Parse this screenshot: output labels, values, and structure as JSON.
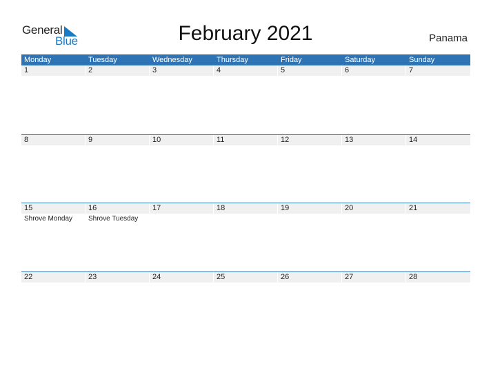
{
  "logo": {
    "line1": "General",
    "line2": "Blue",
    "accent": "#1a7bc4"
  },
  "title": "February 2021",
  "country": "Panama",
  "colors": {
    "header_bg": "#2e74b5",
    "date_bg": "#f0f0f0"
  },
  "weekdays": [
    "Monday",
    "Tuesday",
    "Wednesday",
    "Thursday",
    "Friday",
    "Saturday",
    "Sunday"
  ],
  "weeks": [
    {
      "days": [
        {
          "date": "1",
          "event": ""
        },
        {
          "date": "2",
          "event": ""
        },
        {
          "date": "3",
          "event": ""
        },
        {
          "date": "4",
          "event": ""
        },
        {
          "date": "5",
          "event": ""
        },
        {
          "date": "6",
          "event": ""
        },
        {
          "date": "7",
          "event": ""
        }
      ]
    },
    {
      "days": [
        {
          "date": "8",
          "event": ""
        },
        {
          "date": "9",
          "event": ""
        },
        {
          "date": "10",
          "event": ""
        },
        {
          "date": "11",
          "event": ""
        },
        {
          "date": "12",
          "event": ""
        },
        {
          "date": "13",
          "event": ""
        },
        {
          "date": "14",
          "event": ""
        }
      ]
    },
    {
      "days": [
        {
          "date": "15",
          "event": "Shrove Monday"
        },
        {
          "date": "16",
          "event": "Shrove Tuesday"
        },
        {
          "date": "17",
          "event": ""
        },
        {
          "date": "18",
          "event": ""
        },
        {
          "date": "19",
          "event": ""
        },
        {
          "date": "20",
          "event": ""
        },
        {
          "date": "21",
          "event": ""
        }
      ]
    },
    {
      "days": [
        {
          "date": "22",
          "event": ""
        },
        {
          "date": "23",
          "event": ""
        },
        {
          "date": "24",
          "event": ""
        },
        {
          "date": "25",
          "event": ""
        },
        {
          "date": "26",
          "event": ""
        },
        {
          "date": "27",
          "event": ""
        },
        {
          "date": "28",
          "event": ""
        }
      ]
    }
  ]
}
